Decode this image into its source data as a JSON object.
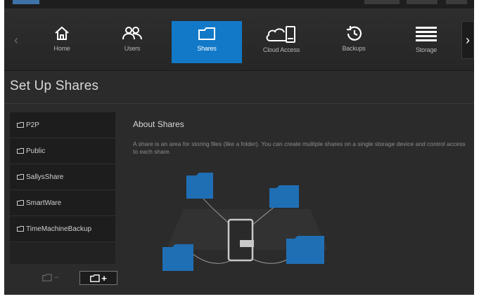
{
  "colors": {
    "accent": "#1279c8",
    "background": "#2b2b2b",
    "folder_blue": "#1f6fb5"
  },
  "nav": {
    "items": [
      {
        "label": "Home",
        "icon": "home-icon",
        "active": false
      },
      {
        "label": "Users",
        "icon": "users-icon",
        "active": false
      },
      {
        "label": "Shares",
        "icon": "folder-icon",
        "active": true
      },
      {
        "label": "Cloud Access",
        "icon": "cloud-device-icon",
        "active": false
      },
      {
        "label": "Backups",
        "icon": "history-icon",
        "active": false
      },
      {
        "label": "Storage",
        "icon": "storage-icon",
        "active": false
      }
    ],
    "left_arrow": "‹",
    "right_arrow": "›"
  },
  "page": {
    "title": "Set Up Shares"
  },
  "shares": {
    "items": [
      "P2P",
      "Public",
      "SallysShare",
      "SmartWare",
      "TimeMachineBackup"
    ],
    "remove_label": "−",
    "add_label": "+"
  },
  "about": {
    "title": "About Shares",
    "text": "A share is an area for storing files (like a folder). You can create multiple shares on a single storage device and control access to each share."
  }
}
